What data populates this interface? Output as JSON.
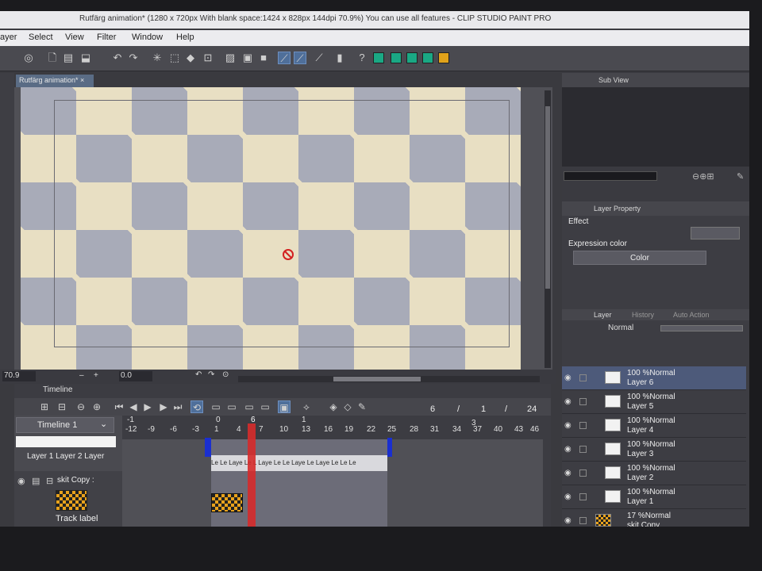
{
  "window": {
    "title": "Rutfärg animation* (1280 x 720px With blank space:1424 x 828px 144dpi 70.9%)  You can use all features - CLIP STUDIO PAINT PRO",
    "controls": [
      "_",
      "□",
      "×"
    ]
  },
  "menu": [
    "ayer",
    "Select",
    "View",
    "Filter",
    "Window",
    "Help"
  ],
  "document_tab": "Rutfärg animation* ×",
  "toolbar": {
    "swatches": [
      "#1aa884",
      "#1aa884",
      "#1aa884",
      "#1aa884",
      "#e0a21a"
    ]
  },
  "status": {
    "zoom": "70.9",
    "angle": "0.0",
    "minus": "–",
    "plus": "+"
  },
  "timeline": {
    "tab": "Timeline",
    "name": "Timeline 1",
    "frame_current": "6",
    "frame_sep": "/",
    "frame_total": "1",
    "frame_sep2": "/",
    "fps": "24",
    "ruler_sec": [
      "-1",
      "0",
      "6",
      "1",
      "3"
    ],
    "ruler_frames": [
      "-12",
      "-9",
      "-6",
      "-3",
      "1",
      "4",
      "7",
      "10",
      "13",
      "16",
      "19",
      "22",
      "25",
      "28",
      "31",
      "34",
      "37",
      "40",
      "43",
      "46"
    ],
    "cells_text": "Le Le Laye Le L Laye Le Le Laye Le Laye  Le Le Le",
    "layer_labels": "Layer 1 Layer 2 Layer",
    "track_name": "skit Copy :",
    "track_label": "Track label"
  },
  "right": {
    "subview_tab": "Sub View",
    "layer_property_tab": "Layer Property",
    "effect_label": "Effect",
    "expression_label": "Expression color",
    "color_button": "Color",
    "layer_tab": "Layer",
    "history_tab": "History",
    "auto_action_tab": "Auto Action",
    "blend_mode": "Normal",
    "layers": [
      {
        "pct": "100 %Normal",
        "name": "Layer 6",
        "active": true
      },
      {
        "pct": "100 %Normal",
        "name": "Layer 5",
        "active": false
      },
      {
        "pct": "100 %Normal",
        "name": "Layer 4",
        "active": false
      },
      {
        "pct": "100 %Normal",
        "name": "Layer 3",
        "active": false
      },
      {
        "pct": "100 %Normal",
        "name": "Layer 2",
        "active": false
      },
      {
        "pct": "100 %Normal",
        "name": "Layer 1",
        "active": false
      },
      {
        "pct": "17 %Normal",
        "name": "skit Copy",
        "active": false,
        "folder": true
      }
    ]
  }
}
